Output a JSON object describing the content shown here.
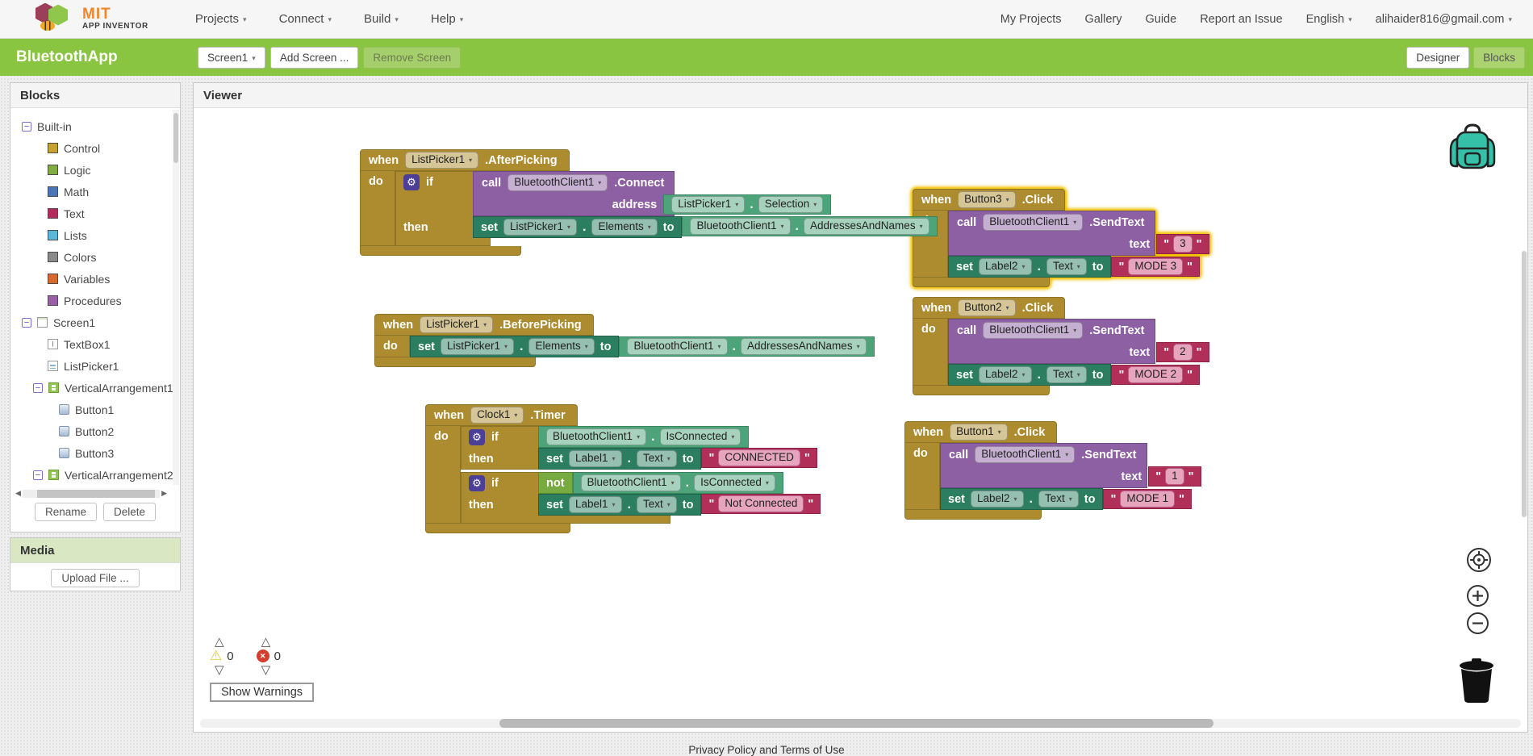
{
  "topbar": {
    "logo_mit": "MIT",
    "logo_sub": "APP INVENTOR",
    "menus": [
      {
        "label": "Projects"
      },
      {
        "label": "Connect"
      },
      {
        "label": "Build"
      },
      {
        "label": "Help"
      }
    ],
    "links": [
      {
        "label": "My Projects"
      },
      {
        "label": "Gallery"
      },
      {
        "label": "Guide"
      },
      {
        "label": "Report an Issue"
      }
    ],
    "language": "English",
    "account": "alihaider816@gmail.com"
  },
  "projectbar": {
    "title": "BluetoothApp",
    "screen": "Screen1",
    "add_screen": "Add Screen ...",
    "remove_screen": "Remove Screen",
    "designer": "Designer",
    "blocks": "Blocks"
  },
  "palette": {
    "header": "Blocks",
    "builtin": {
      "label": "Built-in",
      "items": [
        {
          "label": "Control",
          "color": "#c8a12e"
        },
        {
          "label": "Logic",
          "color": "#7fad41"
        },
        {
          "label": "Math",
          "color": "#4a76b8"
        },
        {
          "label": "Text",
          "color": "#b5295e"
        },
        {
          "label": "Lists",
          "color": "#59b7d8"
        },
        {
          "label": "Colors",
          "color": "#8a8a8a"
        },
        {
          "label": "Variables",
          "color": "#d8692c"
        },
        {
          "label": "Procedures",
          "color": "#9b5ca8"
        }
      ]
    },
    "screen": {
      "label": "Screen1",
      "items": [
        {
          "label": "TextBox1"
        },
        {
          "label": "ListPicker1"
        },
        {
          "label": "VerticalArrangement1",
          "children": [
            {
              "label": "Button1"
            },
            {
              "label": "Button2"
            },
            {
              "label": "Button3"
            }
          ]
        },
        {
          "label": "VerticalArrangement2"
        }
      ]
    },
    "rename": "Rename",
    "delete": "Delete",
    "media_header": "Media",
    "upload": "Upload File ..."
  },
  "viewer": {
    "header": "Viewer",
    "warning_count": "0",
    "error_count": "0",
    "show_warnings": "Show Warnings",
    "footer": "Privacy Policy and Terms of Use"
  },
  "icons": {
    "collapse": "−",
    "tri_up": "△",
    "tri_down": "▽",
    "warning": "⚠",
    "error_x": "✕",
    "gear": "⚙",
    "arrow_left": "◀",
    "arrow_right": "▶"
  },
  "kw": {
    "when": "when",
    "do": "do",
    "then": "then",
    "if": "if",
    "not": "not",
    "call": "call",
    "set": "set",
    "to": "to",
    "dot": ".",
    "quote": "\""
  },
  "groups": {
    "g1": {
      "component": "ListPicker1",
      "event": ".AfterPicking",
      "call_comp": "BluetoothClient1",
      "method": ".Connect",
      "arg": "address",
      "arg_comp": "ListPicker1",
      "arg_prop": "Selection",
      "set_comp": "ListPicker1",
      "set_prop": "Elements",
      "val_comp": "BluetoothClient1",
      "val_prop": "AddressesAndNames"
    },
    "g2": {
      "component": "ListPicker1",
      "event": ".BeforePicking",
      "set_comp": "ListPicker1",
      "set_prop": "Elements",
      "val_comp": "BluetoothClient1",
      "val_prop": "AddressesAndNames"
    },
    "g3": {
      "component": "Clock1",
      "event": ".Timer",
      "cond_comp": "BluetoothClient1",
      "cond_prop": "IsConnected",
      "set_comp": "Label1",
      "set_prop": "Text",
      "val1": "CONNECTED",
      "val2": "Not Connected"
    },
    "g4": {
      "component": "Button3",
      "event": ".Click",
      "call_comp": "BluetoothClient1",
      "method": ".SendText",
      "arg": "text",
      "arg_val": "3",
      "set_comp": "Label2",
      "set_prop": "Text",
      "set_val": "MODE 3"
    },
    "g5": {
      "component": "Button2",
      "event": ".Click",
      "call_comp": "BluetoothClient1",
      "method": ".SendText",
      "arg": "text",
      "arg_val": "2",
      "set_comp": "Label2",
      "set_prop": "Text",
      "set_val": "MODE 2"
    },
    "g6": {
      "component": "Button1",
      "event": ".Click",
      "call_comp": "BluetoothClient1",
      "method": ".SendText",
      "arg": "text",
      "arg_val": "1",
      "set_comp": "Label2",
      "set_prop": "Text",
      "set_val": "MODE 1"
    }
  }
}
